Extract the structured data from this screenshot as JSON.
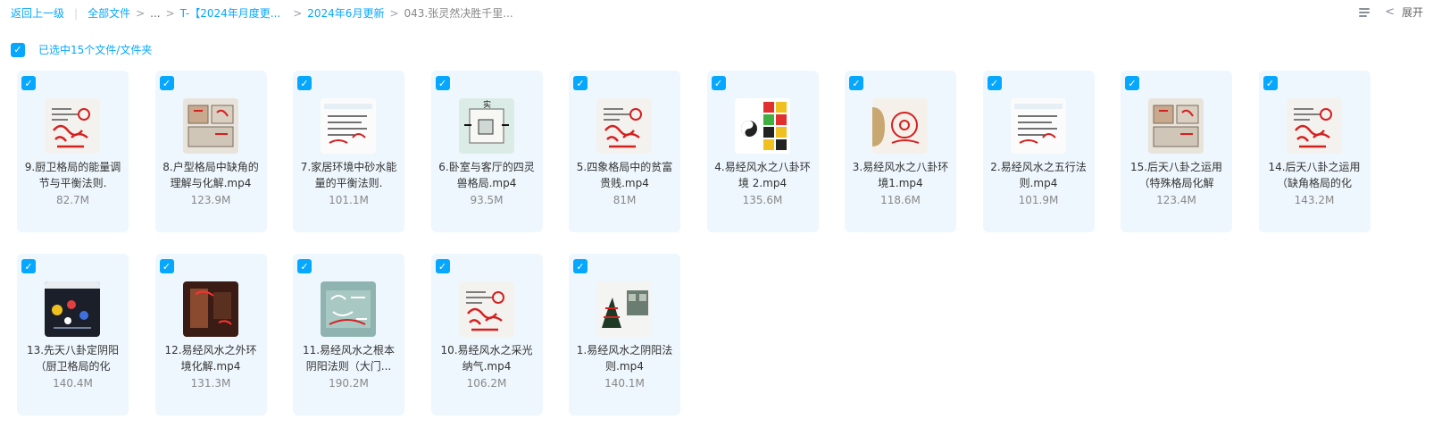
{
  "breadcrumb": {
    "back": "返回上一级",
    "all_files": "全部文件",
    "arrow": ">",
    "ellipsis": "...",
    "folder1": "T-【2024年月度更...",
    "folder2": "2024年6月更新",
    "current": "043.张灵然决胜千里..."
  },
  "toolbar": {
    "list_view_icon": "list-view-icon",
    "collapse_chevron": "<",
    "expand_label": "展开"
  },
  "selection": {
    "check": "✓",
    "text": "已选中15个文件/文件夹"
  },
  "files": [
    {
      "name": "9.厨卫格局的能量调节与平衡法则.",
      "size": "82.7M",
      "thumb": "doc-red"
    },
    {
      "name": "8.户型格局中缺角的理解与化解.mp4",
      "size": "123.9M",
      "thumb": "floorplan"
    },
    {
      "name": "7.家居环境中砂水能量的平衡法则.",
      "size": "101.1M",
      "thumb": "doc-lines"
    },
    {
      "name": "6.卧室与客厅的四灵兽格局.mp4",
      "size": "93.5M",
      "thumb": "diagram-green"
    },
    {
      "name": "5.四象格局中的贫富贵贱.mp4",
      "size": "81M",
      "thumb": "doc-red"
    },
    {
      "name": "4.易经风水之八卦环境 2.mp4",
      "size": "135.6M",
      "thumb": "bagua"
    },
    {
      "name": "3.易经风水之八卦环境1.mp4",
      "size": "118.6M",
      "thumb": "circle-red"
    },
    {
      "name": "2.易经风水之五行法则.mp4",
      "size": "101.9M",
      "thumb": "doc-lines"
    },
    {
      "name": "15.后天八卦之运用（特殊格局化解",
      "size": "123.4M",
      "thumb": "floorplan"
    },
    {
      "name": "14.后天八卦之运用（缺角格局的化",
      "size": "143.2M",
      "thumb": "doc-red"
    },
    {
      "name": "13.先天八卦定阴阳（厨卫格局的化",
      "size": "140.4M",
      "thumb": "dark"
    },
    {
      "name": "12.易经风水之外环境化解.mp4",
      "size": "131.3M",
      "thumb": "photo-room"
    },
    {
      "name": "11.易经风水之根本阴阳法则（大门...",
      "size": "190.2M",
      "thumb": "teal"
    },
    {
      "name": "10.易经风水之采光纳气.mp4",
      "size": "106.2M",
      "thumb": "doc-red"
    },
    {
      "name": "1.易经风水之阴阳法则.mp4",
      "size": "140.1M",
      "thumb": "photo-building"
    }
  ],
  "colors": {
    "accent": "#06a7ff",
    "card_bg": "#eef7fd",
    "name_text": "#333333",
    "size_text": "#888888"
  }
}
